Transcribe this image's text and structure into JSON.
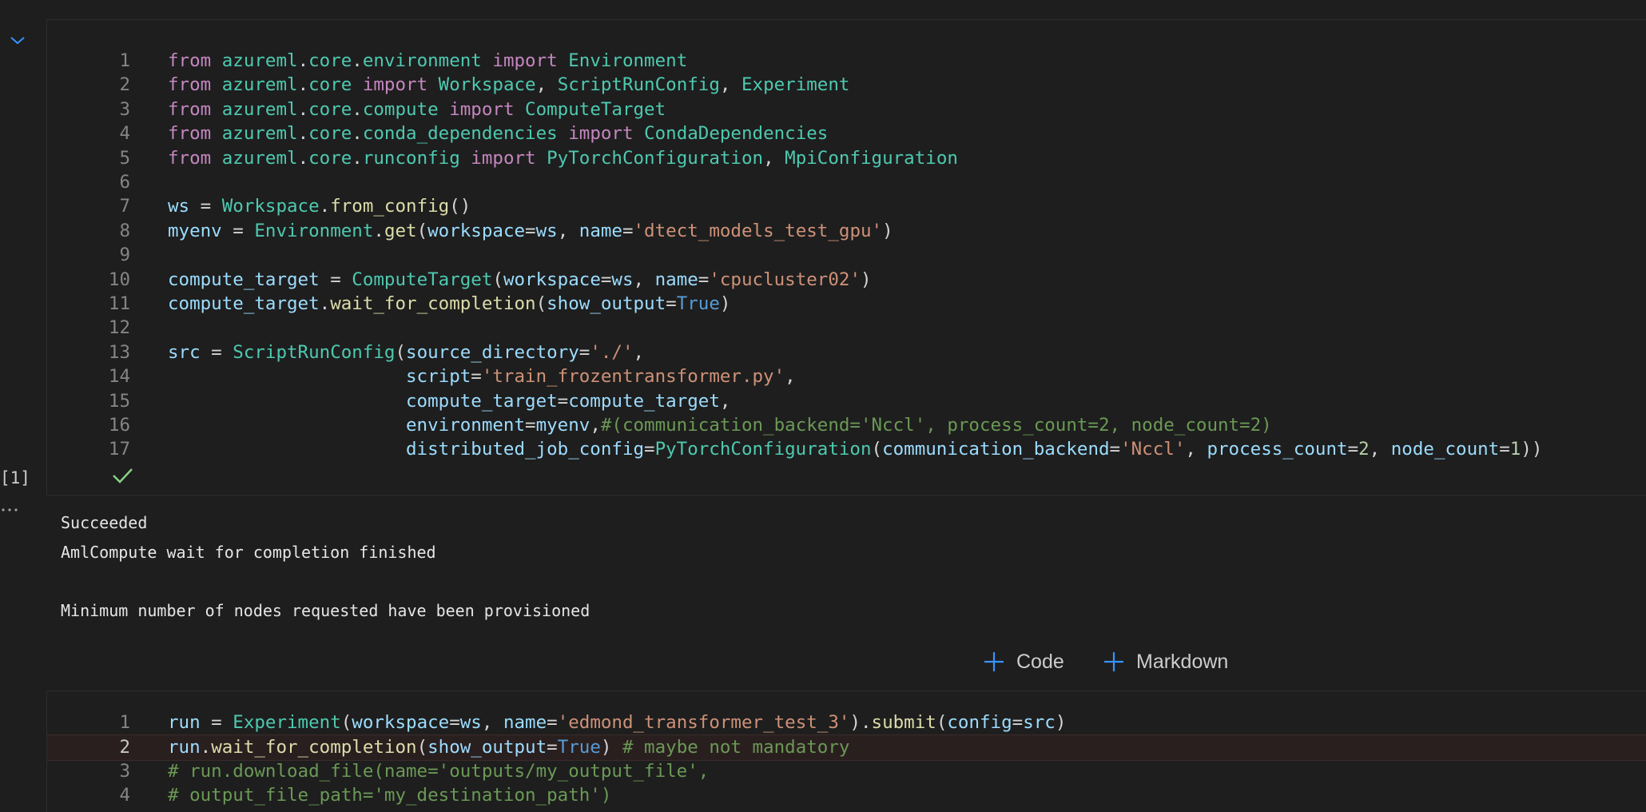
{
  "cell1": {
    "execution_count": "[1]",
    "lines": [
      {
        "n": "1",
        "tokens": [
          [
            "kw",
            "from "
          ],
          [
            "cls",
            "azureml"
          ],
          [
            "pun",
            "."
          ],
          [
            "cls",
            "core"
          ],
          [
            "pun",
            "."
          ],
          [
            "cls",
            "environment"
          ],
          [
            "kw",
            " import "
          ],
          [
            "cls",
            "Environment"
          ]
        ]
      },
      {
        "n": "2",
        "tokens": [
          [
            "kw",
            "from "
          ],
          [
            "cls",
            "azureml"
          ],
          [
            "pun",
            "."
          ],
          [
            "cls",
            "core"
          ],
          [
            "kw",
            " import "
          ],
          [
            "cls",
            "Workspace"
          ],
          [
            "pun",
            ", "
          ],
          [
            "cls",
            "ScriptRunConfig"
          ],
          [
            "pun",
            ", "
          ],
          [
            "cls",
            "Experiment"
          ]
        ]
      },
      {
        "n": "3",
        "tokens": [
          [
            "kw",
            "from "
          ],
          [
            "cls",
            "azureml"
          ],
          [
            "pun",
            "."
          ],
          [
            "cls",
            "core"
          ],
          [
            "pun",
            "."
          ],
          [
            "cls",
            "compute"
          ],
          [
            "kw",
            " import "
          ],
          [
            "cls",
            "ComputeTarget"
          ]
        ]
      },
      {
        "n": "4",
        "tokens": [
          [
            "kw",
            "from "
          ],
          [
            "cls",
            "azureml"
          ],
          [
            "pun",
            "."
          ],
          [
            "cls",
            "core"
          ],
          [
            "pun",
            "."
          ],
          [
            "cls",
            "conda_dependencies"
          ],
          [
            "kw",
            " import "
          ],
          [
            "cls",
            "CondaDependencies"
          ]
        ]
      },
      {
        "n": "5",
        "tokens": [
          [
            "kw",
            "from "
          ],
          [
            "cls",
            "azureml"
          ],
          [
            "pun",
            "."
          ],
          [
            "cls",
            "core"
          ],
          [
            "pun",
            "."
          ],
          [
            "cls",
            "runconfig"
          ],
          [
            "kw",
            " import "
          ],
          [
            "cls",
            "PyTorchConfiguration"
          ],
          [
            "pun",
            ", "
          ],
          [
            "cls",
            "MpiConfiguration"
          ]
        ]
      },
      {
        "n": "6",
        "tokens": []
      },
      {
        "n": "7",
        "tokens": [
          [
            "var",
            "ws"
          ],
          [
            "pun",
            " = "
          ],
          [
            "cls",
            "Workspace"
          ],
          [
            "pun",
            "."
          ],
          [
            "fn",
            "from_config"
          ],
          [
            "pun",
            "()"
          ]
        ]
      },
      {
        "n": "8",
        "tokens": [
          [
            "var",
            "myenv"
          ],
          [
            "pun",
            " = "
          ],
          [
            "cls",
            "Environment"
          ],
          [
            "pun",
            "."
          ],
          [
            "fn",
            "get"
          ],
          [
            "pun",
            "("
          ],
          [
            "var",
            "workspace"
          ],
          [
            "pun",
            "="
          ],
          [
            "var",
            "ws"
          ],
          [
            "pun",
            ", "
          ],
          [
            "var",
            "name"
          ],
          [
            "pun",
            "="
          ],
          [
            "str",
            "'dtect_models_test_gpu'"
          ],
          [
            "pun",
            ")"
          ]
        ]
      },
      {
        "n": "9",
        "tokens": []
      },
      {
        "n": "10",
        "tokens": [
          [
            "var",
            "compute_target"
          ],
          [
            "pun",
            " = "
          ],
          [
            "cls",
            "ComputeTarget"
          ],
          [
            "pun",
            "("
          ],
          [
            "var",
            "workspace"
          ],
          [
            "pun",
            "="
          ],
          [
            "var",
            "ws"
          ],
          [
            "pun",
            ", "
          ],
          [
            "var",
            "name"
          ],
          [
            "pun",
            "="
          ],
          [
            "str",
            "'cpucluster02'"
          ],
          [
            "pun",
            ")"
          ]
        ]
      },
      {
        "n": "11",
        "tokens": [
          [
            "var",
            "compute_target"
          ],
          [
            "pun",
            "."
          ],
          [
            "fn",
            "wait_for_completion"
          ],
          [
            "pun",
            "("
          ],
          [
            "var",
            "show_output"
          ],
          [
            "pun",
            "="
          ],
          [
            "bool",
            "True"
          ],
          [
            "pun",
            ")"
          ]
        ]
      },
      {
        "n": "12",
        "tokens": []
      },
      {
        "n": "13",
        "tokens": [
          [
            "var",
            "src"
          ],
          [
            "pun",
            " = "
          ],
          [
            "cls",
            "ScriptRunConfig"
          ],
          [
            "pun",
            "("
          ],
          [
            "var",
            "source_directory"
          ],
          [
            "pun",
            "="
          ],
          [
            "str",
            "'./'"
          ],
          [
            "pun",
            ","
          ]
        ]
      },
      {
        "n": "14",
        "tokens": [
          [
            "pun",
            "                      "
          ],
          [
            "var",
            "script"
          ],
          [
            "pun",
            "="
          ],
          [
            "str",
            "'train_frozentransformer.py'"
          ],
          [
            "pun",
            ","
          ]
        ]
      },
      {
        "n": "15",
        "tokens": [
          [
            "pun",
            "                      "
          ],
          [
            "var",
            "compute_target"
          ],
          [
            "pun",
            "="
          ],
          [
            "var",
            "compute_target"
          ],
          [
            "pun",
            ","
          ]
        ]
      },
      {
        "n": "16",
        "tokens": [
          [
            "pun",
            "                      "
          ],
          [
            "var",
            "environment"
          ],
          [
            "pun",
            "="
          ],
          [
            "var",
            "myenv"
          ],
          [
            "pun",
            ","
          ],
          [
            "cmt",
            "#(communication_backend='Nccl', process_count=2, node_count=2)"
          ]
        ]
      },
      {
        "n": "17",
        "tokens": [
          [
            "pun",
            "                      "
          ],
          [
            "var",
            "distributed_job_config"
          ],
          [
            "pun",
            "="
          ],
          [
            "cls",
            "PyTorchConfiguration"
          ],
          [
            "pun",
            "("
          ],
          [
            "var",
            "communication_backend"
          ],
          [
            "pun",
            "="
          ],
          [
            "str",
            "'Nccl'"
          ],
          [
            "pun",
            ", "
          ],
          [
            "var",
            "process_count"
          ],
          [
            "pun",
            "="
          ],
          [
            "num",
            "2"
          ],
          [
            "pun",
            ", "
          ],
          [
            "var",
            "node_count"
          ],
          [
            "pun",
            "="
          ],
          [
            "num",
            "1"
          ],
          [
            "pun",
            "))"
          ]
        ]
      }
    ]
  },
  "output": {
    "lines": [
      "Succeeded",
      "AmlCompute wait for completion finished",
      "",
      "Minimum number of nodes requested have been provisioned"
    ]
  },
  "toolbar": {
    "add_code_label": "Code",
    "add_markdown_label": "Markdown"
  },
  "cell2": {
    "lines": [
      {
        "n": "1",
        "tokens": [
          [
            "var",
            "run"
          ],
          [
            "pun",
            " = "
          ],
          [
            "cls",
            "Experiment"
          ],
          [
            "pun",
            "("
          ],
          [
            "var",
            "workspace"
          ],
          [
            "pun",
            "="
          ],
          [
            "var",
            "ws"
          ],
          [
            "pun",
            ", "
          ],
          [
            "var",
            "name"
          ],
          [
            "pun",
            "="
          ],
          [
            "str",
            "'edmond_transformer_test_3'"
          ],
          [
            "pun",
            ")."
          ],
          [
            "fn",
            "submit"
          ],
          [
            "pun",
            "("
          ],
          [
            "var",
            "config"
          ],
          [
            "pun",
            "="
          ],
          [
            "var",
            "src"
          ],
          [
            "pun",
            ")"
          ]
        ]
      },
      {
        "n": "2",
        "tokens": [
          [
            "var",
            "run"
          ],
          [
            "pun",
            "."
          ],
          [
            "fn",
            "wait_for_completion"
          ],
          [
            "pun",
            "("
          ],
          [
            "var",
            "show_output"
          ],
          [
            "pun",
            "="
          ],
          [
            "bool",
            "True"
          ],
          [
            "pun",
            ") "
          ],
          [
            "cmt",
            "# maybe not mandatory"
          ]
        ]
      },
      {
        "n": "3",
        "tokens": [
          [
            "cmt",
            "# run.download_file(name='outputs/my_output_file',"
          ]
        ]
      },
      {
        "n": "4",
        "tokens": [
          [
            "cmt",
            "# output_file_path='my_destination_path')"
          ]
        ]
      }
    ]
  },
  "colors": {
    "background": "#1e1e1e",
    "accent": "#3794ff",
    "success": "#89d185"
  },
  "icons": {
    "collapse": "chevron-down-icon",
    "status": "check-icon",
    "more": "ellipsis-icon",
    "add": "plus-icon"
  }
}
